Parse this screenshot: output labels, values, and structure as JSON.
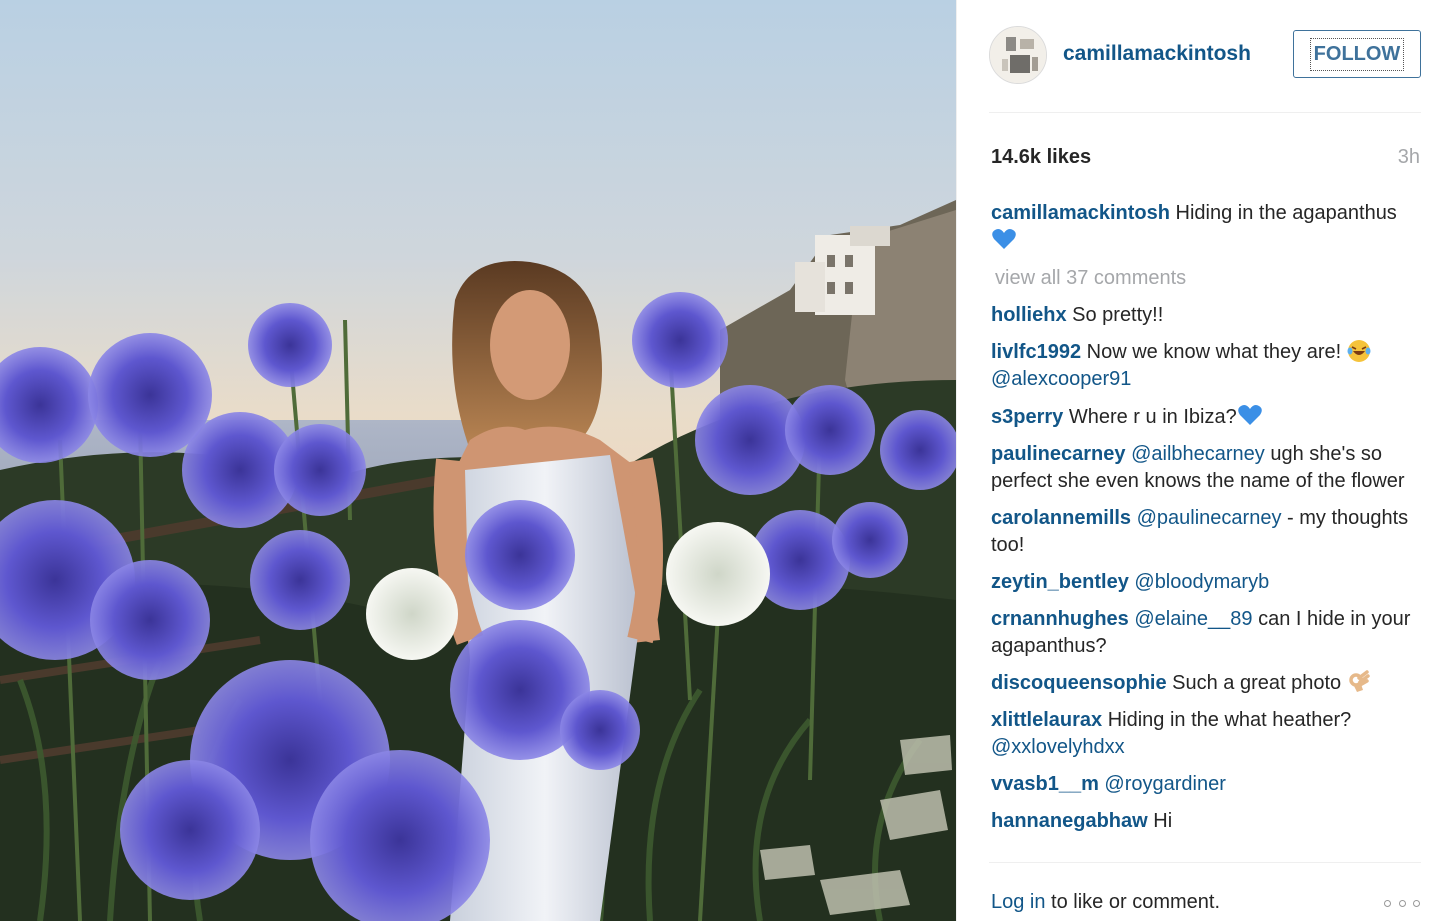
{
  "post": {
    "username": "camillamackintosh",
    "follow_label": "FOLLOW",
    "likes": "14.6k likes",
    "time": "3h",
    "caption": {
      "user": "camillamackintosh",
      "text": "Hiding in the agapanthus",
      "emoji": "blue-heart"
    },
    "view_all": "view all 37 comments",
    "comments": [
      {
        "user": "holliehx",
        "text": " So pretty!!"
      },
      {
        "user": "livlfc1992",
        "text": " Now we know what they are! ",
        "emoji": "laughing-tears",
        "mention": "@alexcooper91"
      },
      {
        "user": "s3perry",
        "text": " Where r u in Ibiza?",
        "emoji": "blue-heart"
      },
      {
        "user": "paulinecarney",
        "mention": " @ailbhecarney",
        "text": " ugh she's so perfect she even knows the name of the flower"
      },
      {
        "user": "carolannemills",
        "mention": " @paulinecarney",
        "text": " - my thoughts too!"
      },
      {
        "user": "zeytin_bentley",
        "mention": " @bloodymaryb",
        "text": ""
      },
      {
        "user": "crnannhughes",
        "mention": " @elaine__89",
        "text": " can I hide in your agapanthus?"
      },
      {
        "user": "discoqueensophie",
        "text": " Such a great photo ",
        "emoji": "ok-hand"
      },
      {
        "user": "xlittlelaurax",
        "text": " Hiding in the what heather? ",
        "mention2": "@xxlovelyhdxx"
      },
      {
        "user": "vvasb1__m",
        "mention": " @roygardiner",
        "text": ""
      },
      {
        "user": "hannanegabhaw",
        "text": " Hi"
      }
    ],
    "footer": {
      "login": "Log in",
      "rest": " to like or comment."
    }
  },
  "colors": {
    "link": "#125688",
    "follow": "#3f729b",
    "muted": "#a5a7aa",
    "flower": "#5b55c9"
  },
  "icons": {
    "more": "more-options-icon",
    "heart": "blue-heart-icon"
  }
}
